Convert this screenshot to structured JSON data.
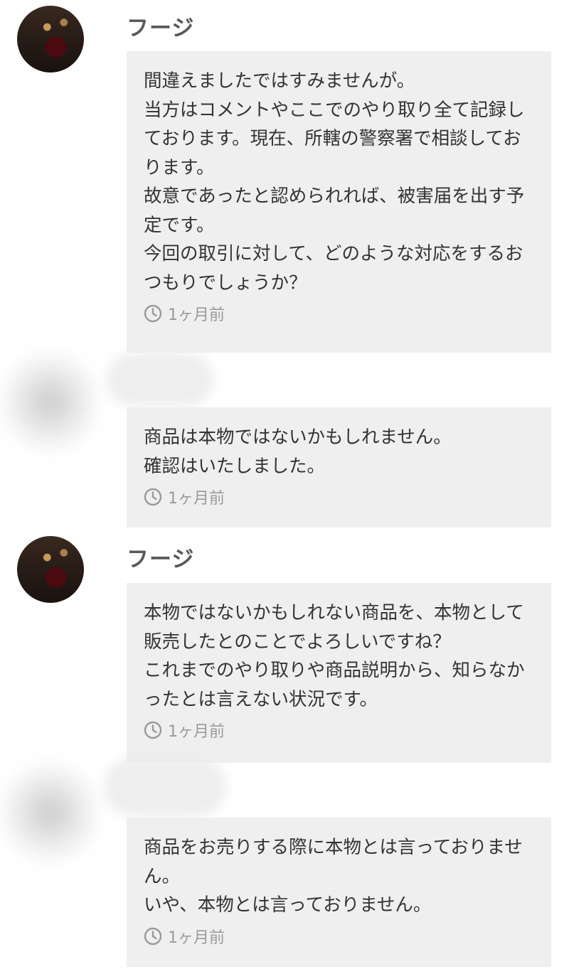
{
  "messages": [
    {
      "sender": "フージ",
      "text": "間違えましたではすみませんが。\n当方はコメントやここでのやり取り全て記録しております。現在、所轄の警察署で相談しております。\n故意であったと認められれば、被害届を出す予定です。\n今回の取引に対して、どのような対応をするおつもりでしょうか？",
      "time": "1ヶ月前"
    },
    {
      "sender": "",
      "text": "商品は本物ではないかもしれません。\n確認はいたしました。",
      "time": "1ヶ月前"
    },
    {
      "sender": "フージ",
      "text": "本物ではないかもしれない商品を、本物として販売したとのことでよろしいですね？\nこれまでのやり取りや商品説明から、知らなかったとは言えない状況です。",
      "time": "1ヶ月前"
    },
    {
      "sender": "",
      "text": "商品をお売りする際に本物とは言っておりません。\nいや、本物とは言っておりません。",
      "time": "1ヶ月前"
    }
  ],
  "icons": {
    "timestamp": "clock-icon",
    "avatar": "avatar-photo"
  },
  "colors": {
    "bubble_background": "#efefef",
    "sender_name": "#595959",
    "timestamp": "#9a9a9a"
  }
}
